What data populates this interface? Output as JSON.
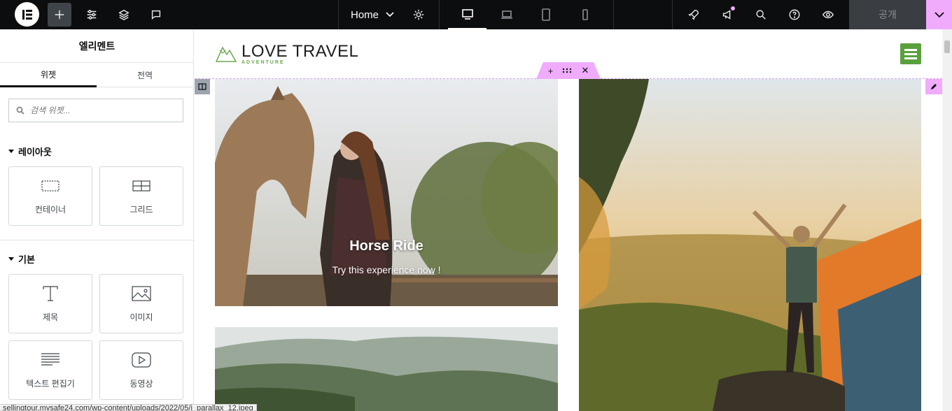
{
  "topbar": {
    "page_name": "Home",
    "publish_label": "공개"
  },
  "panel": {
    "title": "엘리멘트",
    "tabs": [
      {
        "label": "위젯"
      },
      {
        "label": "전역"
      }
    ],
    "search_placeholder": "검색 위젯...",
    "sections": [
      {
        "title": "레이아웃",
        "widgets": [
          {
            "label": "컨테이너",
            "icon": "container-icon"
          },
          {
            "label": "그리드",
            "icon": "grid-icon"
          }
        ]
      },
      {
        "title": "기본",
        "widgets": [
          {
            "label": "제목",
            "icon": "heading-icon"
          },
          {
            "label": "이미지",
            "icon": "image-icon"
          },
          {
            "label": "텍스트 편집기",
            "icon": "text-editor-icon"
          },
          {
            "label": "동영상",
            "icon": "video-icon"
          }
        ]
      }
    ]
  },
  "site": {
    "logo_title": "LOVE TRAVEL",
    "logo_sub": "ADVENTURE",
    "brand_color": "#5aa03c",
    "cards": [
      {
        "title": "Horse Ride",
        "subtitle": "Try this experience now !"
      }
    ]
  },
  "statusbar": {
    "url": "sellingtour.mysafe24.com/wp-content/uploads/2022/05/i_parallax_12.jpeg"
  },
  "colors": {
    "topbar": "#0c0d0e",
    "accent": "#f0abfc"
  }
}
